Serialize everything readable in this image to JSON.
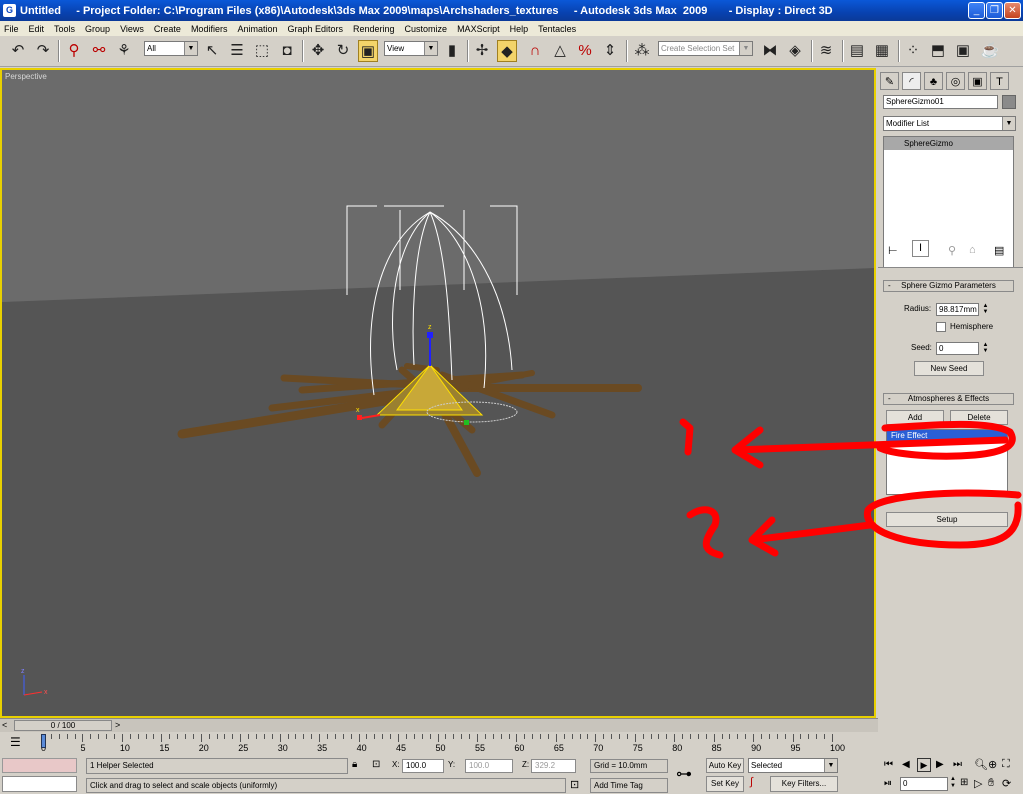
{
  "window": {
    "title": "Untitled     - Project Folder: C:\\Program Files (x86)\\Autodesk\\3ds Max 2009\\maps\\Archshaders_textures     - Autodesk 3ds Max  2009       - Display : Direct 3D",
    "app_icon": "G"
  },
  "menu": [
    "File",
    "Edit",
    "Tools",
    "Group",
    "Views",
    "Create",
    "Modifiers",
    "Animation",
    "Graph Editors",
    "Rendering",
    "Customize",
    "MAXScript",
    "Help",
    "Tentacles"
  ],
  "toolbar": {
    "selection_filter": "All",
    "reference_coord": "View",
    "named_selection_placeholder": "Create Selection Set"
  },
  "viewport": {
    "label": "Perspective",
    "axis_z": "z",
    "axis_x": "x",
    "gizmo_z": "z",
    "gizmo_x": "x",
    "annotations": {
      "one": "1",
      "two": "2"
    },
    "annotation_color": "#ff0000"
  },
  "command_panel": {
    "object_name": "SphereGizmo01",
    "modifier_list": "Modifier List",
    "stack_item": "SphereGizmo",
    "rollout_params": {
      "title": "Sphere Gizmo Parameters",
      "collapse": "-",
      "radius_label": "Radius:",
      "radius_value": "98.817mm",
      "hemisphere_label": "Hemisphere",
      "seed_label": "Seed:",
      "seed_value": "0",
      "new_seed": "New Seed"
    },
    "rollout_atmos": {
      "title": "Atmospheres & Effects",
      "collapse": "-",
      "add": "Add",
      "delete": "Delete",
      "effects": [
        "Fire Effect"
      ],
      "setup": "Setup"
    }
  },
  "timeline": {
    "frame_display": "0 / 100",
    "ticks": [
      "0",
      "5",
      "10",
      "15",
      "20",
      "25",
      "30",
      "35",
      "40",
      "45",
      "50",
      "55",
      "60",
      "65",
      "70",
      "75",
      "80",
      "85",
      "90",
      "95",
      "100"
    ]
  },
  "status": {
    "selection_count": "1 Helper Selected",
    "prompt": "Click and drag to select and scale objects (uniformly)",
    "x_label": "X:",
    "x_value": "100.0",
    "y_label": "Y:",
    "y_value": "100.0",
    "z_label": "Z:",
    "z_value": "329.2",
    "grid": "Grid = 10.0mm",
    "add_time_tag": "Add Time Tag"
  },
  "animation_controls": {
    "auto_key": "Auto Key",
    "set_key": "Set Key",
    "key_mode": "Selected",
    "key_filters": "Key Filters...",
    "current_frame": "0"
  }
}
